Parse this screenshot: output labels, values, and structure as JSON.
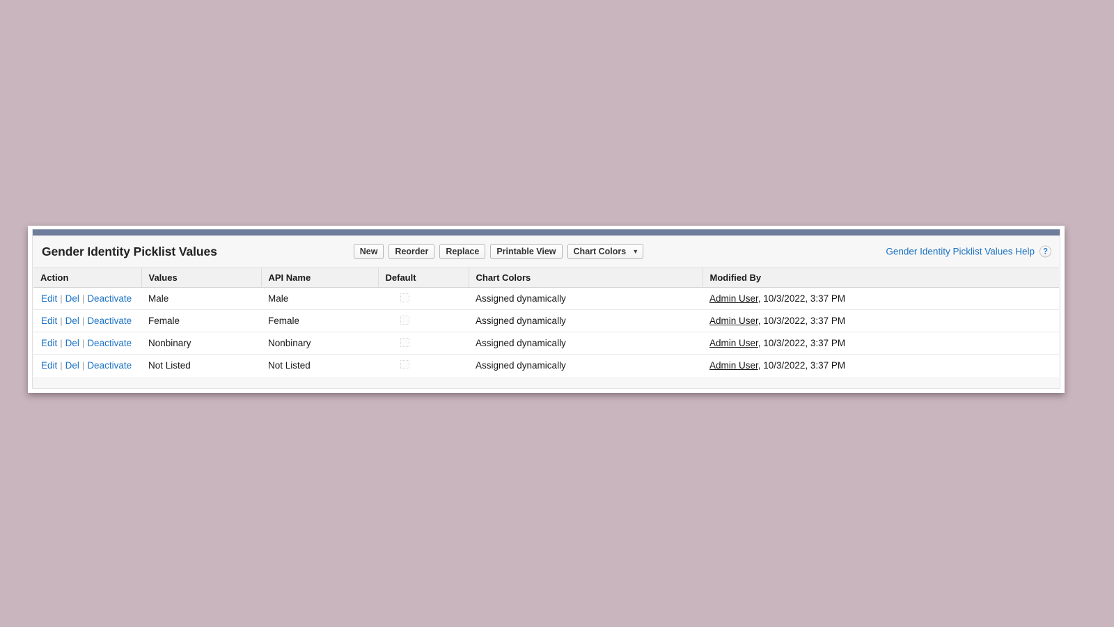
{
  "panel": {
    "title": "Gender Identity Picklist Values",
    "help_link": "Gender Identity Picklist Values Help",
    "help_icon": "?"
  },
  "toolbar": {
    "new_label": "New",
    "reorder_label": "Reorder",
    "replace_label": "Replace",
    "printable_view_label": "Printable View",
    "chart_colors_label": "Chart Colors",
    "chart_colors_caret": "▼"
  },
  "table": {
    "columns": [
      "Action",
      "Values",
      "API Name",
      "Default",
      "Chart Colors",
      "Modified By"
    ],
    "actions": {
      "edit": "Edit",
      "del": "Del",
      "deactivate": "Deactivate",
      "separator": "|"
    },
    "rows": [
      {
        "value": "Male",
        "api_name": "Male",
        "default_checked": false,
        "chart_color": "Assigned dynamically",
        "modified_user": "Admin User",
        "modified_rest": ", 10/3/2022, 3:37 PM"
      },
      {
        "value": "Female",
        "api_name": "Female",
        "default_checked": false,
        "chart_color": "Assigned dynamically",
        "modified_user": "Admin User",
        "modified_rest": ", 10/3/2022, 3:37 PM"
      },
      {
        "value": "Nonbinary",
        "api_name": "Nonbinary",
        "default_checked": false,
        "chart_color": "Assigned dynamically",
        "modified_user": "Admin User",
        "modified_rest": ", 10/3/2022, 3:37 PM"
      },
      {
        "value": "Not Listed",
        "api_name": "Not Listed",
        "default_checked": false,
        "chart_color": "Assigned dynamically",
        "modified_user": "Admin User",
        "modified_rest": ", 10/3/2022, 3:37 PM"
      }
    ]
  },
  "colors": {
    "page_background": "#c9b5bd",
    "accent_bar": "#6f7d9c",
    "link": "#1b72c4",
    "header_row": "#f1f1f1"
  }
}
